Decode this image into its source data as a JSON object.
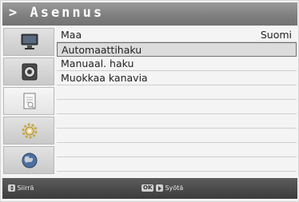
{
  "header": {
    "title": "> Asennus"
  },
  "sidebar": {
    "items": [
      {
        "icon": "tv-icon"
      },
      {
        "icon": "speaker-icon"
      },
      {
        "icon": "document-icon"
      },
      {
        "icon": "gear-icon"
      },
      {
        "icon": "globe-icon"
      }
    ],
    "active_index": 2
  },
  "menu": {
    "rows": [
      {
        "label": "Maa",
        "value": "Suomi"
      },
      {
        "label": "Automaattihaku",
        "value": ""
      },
      {
        "label": "Manuaal. haku",
        "value": ""
      },
      {
        "label": "Muokkaa kanavia",
        "value": ""
      },
      {
        "label": "",
        "value": ""
      },
      {
        "label": "",
        "value": ""
      },
      {
        "label": "",
        "value": ""
      },
      {
        "label": "",
        "value": ""
      },
      {
        "label": "",
        "value": ""
      },
      {
        "label": "",
        "value": ""
      }
    ],
    "selected_index": 1
  },
  "footer": {
    "move_hint": "Siirrä",
    "ok_key": "OK",
    "enter_hint": "Syötä"
  },
  "colors": {
    "title_bar": "#8a8a8a",
    "footer": "#4a4a4a",
    "selection": "#dcdcdc"
  }
}
